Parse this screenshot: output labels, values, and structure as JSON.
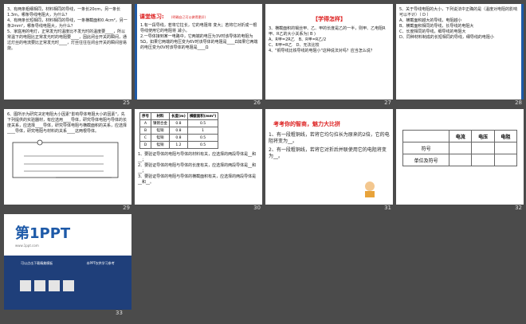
{
  "slides": [
    {
      "num": "25",
      "lines": [
        "3、有两条粗细相同，材料相同的导线，一条长20cm，另一条长1.3m，哪条导线电阻大，为什么？",
        "4、有两条长短相同，材料相同的导线，一条横截面积0.4cm²，另一条2mm²，哪条导线电阻大，为什么？",
        "5、家庭用的电灯，正常发光时温度比不发光时的温度要____，所以常温下的电阻比正常发光时的电阻要____，因此闭合开关的瞬间，通过灯丝的电流要比正常发光时____，灯丝往往在闭合开关的瞬间容易烧。"
      ]
    },
    {
      "num": "26",
      "title": "课堂练习:",
      "subtitle": "(明确自己可以做得更好)",
      "lines": [
        "1.有一段导线，若将它拉长，它的电阻将 变大；若将它对折成一根导线使用它的电阻将 减小。",
        "2.一导体接到某一电路中，它两端的电压为3V时该导体的电阻为5Ω，如果它两端的电压变为6V时该导体的电阻是____Ω如果它两端的电压变为0V时该导体的电阻是____Ω"
      ]
    },
    {
      "num": "27",
      "title": "【学得怎样】",
      "lines": [
        "3、横截面积的锡丝甲、乙、甲的长度是乙的一半，则甲、乙电阻R甲、R乙的大小关系为( B )",
        "A、R甲=2R乙　B、R甲=R乙/2",
        "C、R甲=R乙　D、无法比较",
        "4、\"铜导线比铁导线的电阻小\"这种说法对吗？应当怎么说？"
      ]
    },
    {
      "num": "28",
      "lines": [
        "5、关于导线电阻的大小，下列说法中正确的是（温度对电阻的影响可以不计）（ D ）",
        "A、横截面积越大的导线，电阻越小",
        "B、横截面积相同的导线，长导线的电阻大",
        "C、长度相同的导线，细导线的电阻大",
        "D、同种材料制成的长短相同的导线，细导线的电阻小"
      ]
    },
    {
      "num": "29",
      "lines": [
        "6、图所示为研究决定电阻大小因素\"影响导体电阻大小的因素\"，先下列提供的实验器材，有应选用____导体，研究导体电阻与导体的长度关系，应选择____导体，研究导体电阻与横截面积的关系，应选择____导体，研究电阻与材料的关系____这两根导体。"
      ]
    },
    {
      "num": "30",
      "table": {
        "headers": [
          "序号",
          "材料",
          "长度(m)",
          "横截面积(mm²)"
        ],
        "rows": [
          [
            "A",
            "镍铬合金",
            "0.8",
            "0.5"
          ],
          [
            "B",
            "锰铜",
            "0.8",
            "1"
          ],
          [
            "C",
            "锰铜",
            "0.8",
            "0.5"
          ],
          [
            "D",
            "锰铜",
            "1.2",
            "0.5"
          ]
        ]
      },
      "lines": [
        "1、要验证导体的电阻与导体的材料有关，应选择的两段导体是__和__；",
        "2、要验证导体的电阻与导体的长度有关，应选择的两段导体是__和__；",
        "3、要验证导体的电阻与导体的横截面积有关，应选择的两段导体是__和__。"
      ]
    },
    {
      "num": "31",
      "title": "考考你的智商，魅力大比拼",
      "lines": [
        "1、有一段粗铜线，若将它均匀拉长为原来的2倍，它的电阻将变为__。",
        "2、有一段粗铜线，若将它对折后并联使用它的电阻将变为__。"
      ]
    },
    {
      "num": "32",
      "table": {
        "headers": [
          "",
          "电流",
          "电压",
          "电阻"
        ],
        "rows": [
          [
            "符号",
            "",
            "",
            ""
          ],
          [
            "单位及符号",
            "",
            "",
            ""
          ]
        ]
      }
    },
    {
      "num": "33",
      "logo": "第1PPT",
      "logo_sub": "www.1ppt.com",
      "footer_left": "可以点击下载精美模板",
      "footer_right": "本PPT仅供学习参考"
    }
  ],
  "colors": {
    "accent": "#1e5aa8",
    "red": "#dd2222",
    "bg": "#4b4b4b"
  }
}
